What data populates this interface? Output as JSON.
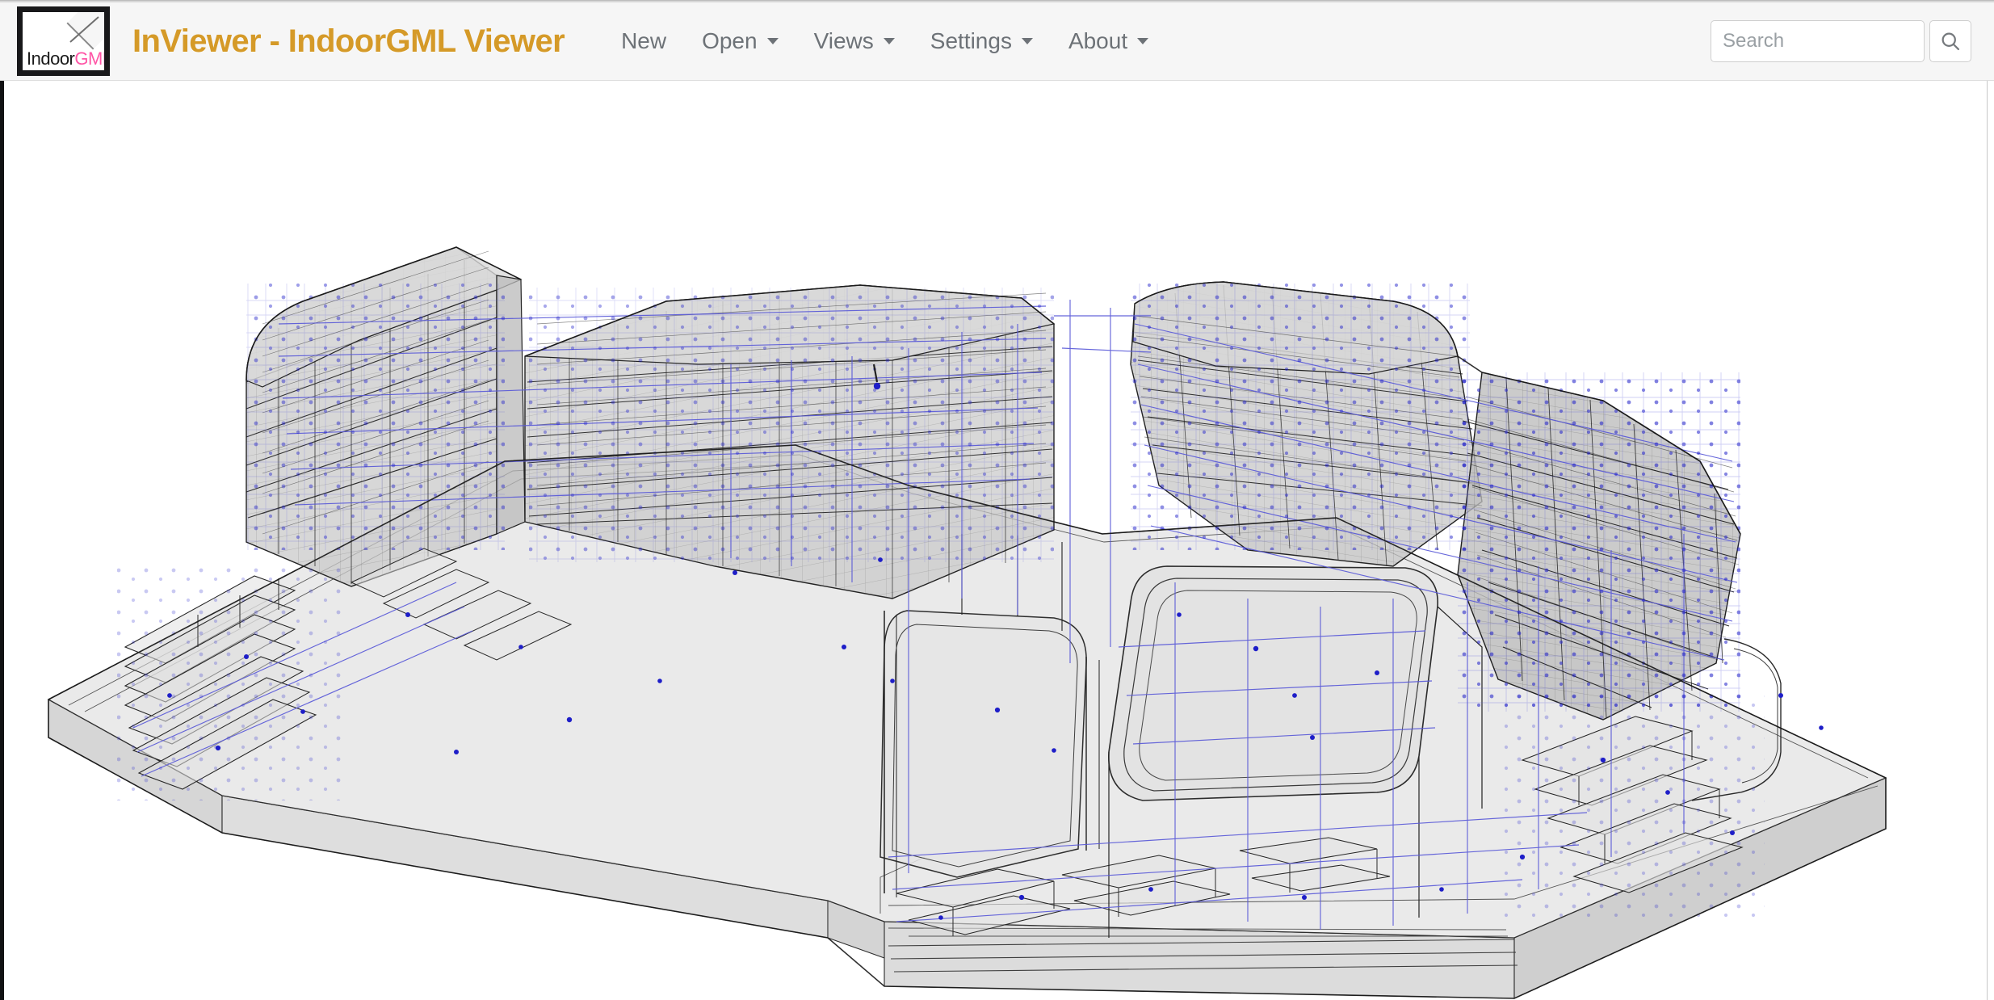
{
  "window": {
    "title": "InViewer - IndoorGML Viewer"
  },
  "header": {
    "logo": {
      "name": "indoorgml-logo",
      "text_dark": "Indoor",
      "text_pink": "GML",
      "pink_color": "#ff55a6",
      "dark_color": "#1a1a1a"
    },
    "brand_title": "InViewer - IndoorGML Viewer",
    "brand_color": "#d59a28",
    "background_color": "#f6f6f6",
    "nav": [
      {
        "label": "New",
        "has_caret": false,
        "name": "nav-new"
      },
      {
        "label": "Open",
        "has_caret": true,
        "name": "nav-open"
      },
      {
        "label": "Views",
        "has_caret": true,
        "name": "nav-views"
      },
      {
        "label": "Settings",
        "has_caret": true,
        "name": "nav-settings"
      },
      {
        "label": "About",
        "has_caret": true,
        "name": "nav-about"
      }
    ],
    "search": {
      "placeholder": "Search",
      "value": "",
      "button_icon": "search-icon"
    }
  },
  "viewport": {
    "name": "indoorgml-3d-viewport",
    "background_color": "#ffffff",
    "model": {
      "description": "IndoorGML 3D building model rendered as transparent wireframe",
      "face_fill": "#e7e7e7",
      "face_fill_dark": "#cfcfcf",
      "edge_color": "#222222",
      "network_edge_color": "#5a5ad8",
      "network_node_color": "#1e1ec8"
    }
  }
}
